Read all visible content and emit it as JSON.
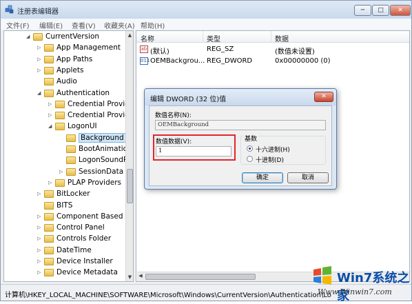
{
  "window": {
    "title": "注册表编辑器",
    "controls": {
      "minimize": "─",
      "maximize": "□",
      "close": "✕"
    }
  },
  "menu": [
    "文件(F)",
    "编辑(E)",
    "查看(V)",
    "收藏夹(A)",
    "帮助(H)"
  ],
  "tree": [
    {
      "label": "CurrentVersion",
      "arrow": "◢",
      "level": 0
    },
    {
      "label": "App Management",
      "arrow": "▷",
      "level": 1
    },
    {
      "label": "App Paths",
      "arrow": "▷",
      "level": 1
    },
    {
      "label": "Applets",
      "arrow": "▷",
      "level": 1
    },
    {
      "label": "Audio",
      "arrow": "",
      "level": 1
    },
    {
      "label": "Authentication",
      "arrow": "◢",
      "level": 1
    },
    {
      "label": "Credential Provid",
      "arrow": "▷",
      "level": 2
    },
    {
      "label": "Credential Provid",
      "arrow": "▷",
      "level": 2
    },
    {
      "label": "LogonUI",
      "arrow": "◢",
      "level": 2
    },
    {
      "label": "Background",
      "arrow": "",
      "level": 3,
      "selected": true
    },
    {
      "label": "BootAnimatio",
      "arrow": "",
      "level": 3
    },
    {
      "label": "LogonSoundP",
      "arrow": "",
      "level": 3
    },
    {
      "label": "SessionData",
      "arrow": "▷",
      "level": 3
    },
    {
      "label": "PLAP Providers",
      "arrow": "▷",
      "level": 2
    },
    {
      "label": "BitLocker",
      "arrow": "▷",
      "level": 1
    },
    {
      "label": "BITS",
      "arrow": "",
      "level": 1
    },
    {
      "label": "Component Based S",
      "arrow": "▷",
      "level": 1
    },
    {
      "label": "Control Panel",
      "arrow": "▷",
      "level": 1
    },
    {
      "label": "Controls Folder",
      "arrow": "▷",
      "level": 1
    },
    {
      "label": "DateTime",
      "arrow": "▷",
      "level": 1
    },
    {
      "label": "Device Installer",
      "arrow": "▷",
      "level": 1
    },
    {
      "label": "Device Metadata",
      "arrow": "▷",
      "level": 1
    }
  ],
  "list": {
    "headers": {
      "name": "名称",
      "type": "类型",
      "data": "数据"
    },
    "rows": [
      {
        "icon": "ab",
        "name": "(默认)",
        "type": "REG_SZ",
        "data": "(数值未设置)"
      },
      {
        "icon": "011",
        "name": "OEMBackgrou...",
        "type": "REG_DWORD",
        "data": "0x00000000 (0)"
      }
    ]
  },
  "status": "计算机\\HKEY_LOCAL_MACHINE\\SOFTWARE\\Microsoft\\Windows\\CurrentVersion\\Authentication\\Lo",
  "watermark": {
    "text": "Win7系统之家",
    "url": "Www.Winwin7.com"
  },
  "dialog": {
    "title": "编辑 DWORD (32 位)值",
    "close": "✕",
    "name_label": "数值名称(N):",
    "name_value": "OEMBackground",
    "data_label": "数值数据(V):",
    "data_value": "1",
    "base_label": "基数",
    "radio_hex": "十六进制(H)",
    "radio_dec": "十进制(D)",
    "ok": "确定",
    "cancel": "取消"
  }
}
